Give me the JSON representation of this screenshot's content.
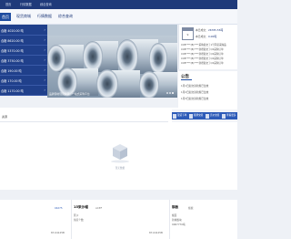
{
  "topbar": {
    "items": [
      "首页",
      "行情数据",
      "综合查询"
    ]
  },
  "nav": {
    "items": [
      "首页",
      "现货商城",
      "行情数据",
      "综合查询"
    ]
  },
  "sidebar": {
    "items": [
      {
        "label": "合格 4020.00 吨"
      },
      {
        "label": "合格 8620.00 吨"
      },
      {
        "label": "合格 5370.00 吨"
      },
      {
        "label": "合格 3750.00 吨"
      },
      {
        "label": "合格 190.00 吨"
      },
      {
        "label": "合格 170.00 吨"
      },
      {
        "label": "合格 1170.00 吨"
      }
    ]
  },
  "banner": {
    "caption": "品牌钢材现货资源 · 一站式采购平台"
  },
  "date_panel": {
    "day": "9",
    "line1_label": "本日成交：",
    "line1_value": "26785.55吨",
    "line2_label": "本日成交：",
    "line2_value": "0.00吨",
    "news": [
      "CCB****(B)****采购提交了1号同意采购品",
      "CCB****(B)****新增提交了Q2采购订单",
      "CCB****(B)****新增提交了Q2采购订单",
      "CCB****(B)****新增提交了Q2采购订单",
      "CCB****(B)****新增提交了Q2采购订单"
    ]
  },
  "notice": {
    "title": "公告",
    "items": [
      "1月1日起交割新规已生效",
      "1月2日起交割新规已生效",
      "1月3日起交割新规已生效"
    ]
  },
  "section2": {
    "title": "资源",
    "tools": [
      "现货下单",
      "挂牌交易",
      "竞价交易",
      "查看更多"
    ],
    "empty_text": "暂无数据"
  },
  "bottom_cards": [
    {
      "title": "",
      "sub": "",
      "price": "04275",
      "lines": [
        "",
        "",
        ""
      ],
      "right": "87-04125B"
    },
    {
      "title": "15采沙帽",
      "sub": "ACEF",
      "price": "",
      "lines": [
        "区沙",
        "供应个数",
        ""
      ],
      "right": "87-04125B"
    },
    {
      "title": "钢板",
      "sub": "板板",
      "price": "",
      "lines": [
        "板面",
        "新城板块",
        "9067770吨"
      ],
      "right": ""
    }
  ]
}
